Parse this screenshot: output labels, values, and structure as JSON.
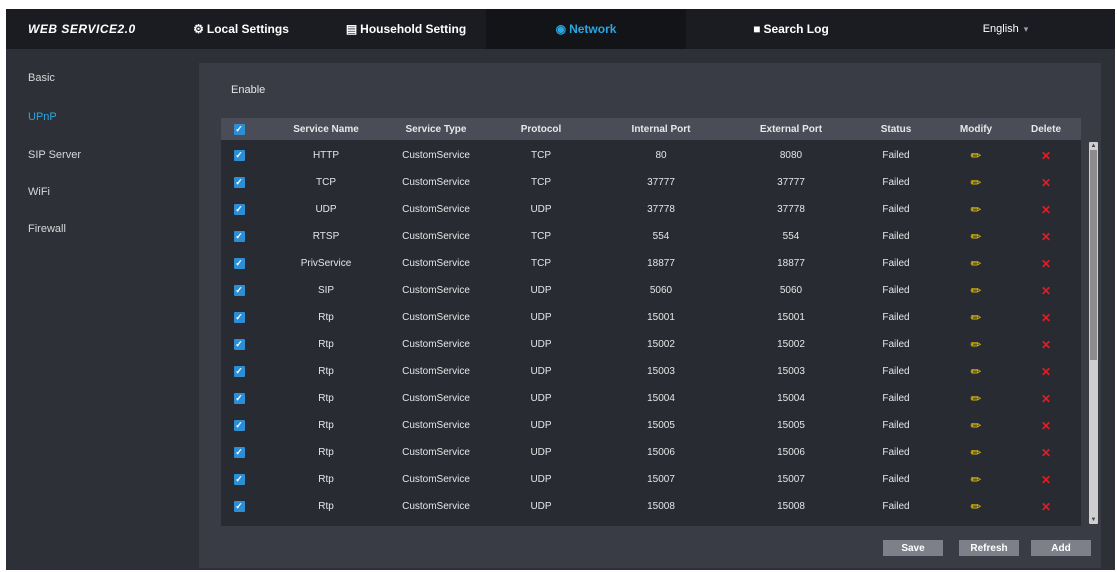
{
  "app": {
    "logo": "WEB SERVICE2.0"
  },
  "nav": {
    "tabs": [
      {
        "label": "Local Settings",
        "icon": "gear-icon"
      },
      {
        "label": "Household Setting",
        "icon": "building-icon"
      },
      {
        "label": "Network",
        "icon": "globe-icon",
        "active": true
      },
      {
        "label": "Search Log",
        "icon": "document-icon"
      }
    ],
    "language": "English"
  },
  "sidebar": {
    "items": [
      {
        "label": "Basic"
      },
      {
        "label": "UPnP",
        "active": true
      },
      {
        "label": "SIP Server"
      },
      {
        "label": "WiFi"
      },
      {
        "label": "Firewall"
      }
    ]
  },
  "upnp": {
    "enable_label": "Enable",
    "headers": [
      "Service Name",
      "Service Type",
      "Protocol",
      "Internal Port",
      "External Port",
      "Status",
      "Modify",
      "Delete"
    ],
    "rows": [
      {
        "name": "HTTP",
        "type": "CustomService",
        "protocol": "TCP",
        "internal": "80",
        "external": "8080",
        "status": "Failed"
      },
      {
        "name": "TCP",
        "type": "CustomService",
        "protocol": "TCP",
        "internal": "37777",
        "external": "37777",
        "status": "Failed"
      },
      {
        "name": "UDP",
        "type": "CustomService",
        "protocol": "UDP",
        "internal": "37778",
        "external": "37778",
        "status": "Failed"
      },
      {
        "name": "RTSP",
        "type": "CustomService",
        "protocol": "TCP",
        "internal": "554",
        "external": "554",
        "status": "Failed"
      },
      {
        "name": "PrivService",
        "type": "CustomService",
        "protocol": "TCP",
        "internal": "18877",
        "external": "18877",
        "status": "Failed"
      },
      {
        "name": "SIP",
        "type": "CustomService",
        "protocol": "UDP",
        "internal": "5060",
        "external": "5060",
        "status": "Failed"
      },
      {
        "name": "Rtp",
        "type": "CustomService",
        "protocol": "UDP",
        "internal": "15001",
        "external": "15001",
        "status": "Failed"
      },
      {
        "name": "Rtp",
        "type": "CustomService",
        "protocol": "UDP",
        "internal": "15002",
        "external": "15002",
        "status": "Failed"
      },
      {
        "name": "Rtp",
        "type": "CustomService",
        "protocol": "UDP",
        "internal": "15003",
        "external": "15003",
        "status": "Failed"
      },
      {
        "name": "Rtp",
        "type": "CustomService",
        "protocol": "UDP",
        "internal": "15004",
        "external": "15004",
        "status": "Failed"
      },
      {
        "name": "Rtp",
        "type": "CustomService",
        "protocol": "UDP",
        "internal": "15005",
        "external": "15005",
        "status": "Failed"
      },
      {
        "name": "Rtp",
        "type": "CustomService",
        "protocol": "UDP",
        "internal": "15006",
        "external": "15006",
        "status": "Failed"
      },
      {
        "name": "Rtp",
        "type": "CustomService",
        "protocol": "UDP",
        "internal": "15007",
        "external": "15007",
        "status": "Failed"
      },
      {
        "name": "Rtp",
        "type": "CustomService",
        "protocol": "UDP",
        "internal": "15008",
        "external": "15008",
        "status": "Failed"
      }
    ],
    "buttons": {
      "save": "Save",
      "refresh": "Refresh",
      "add": "Add"
    }
  },
  "colors": {
    "accent": "#2aa7e0",
    "checkbox": "#2c8fd6",
    "modify_icon": "#ffd700",
    "delete_icon": "#e51c23"
  }
}
